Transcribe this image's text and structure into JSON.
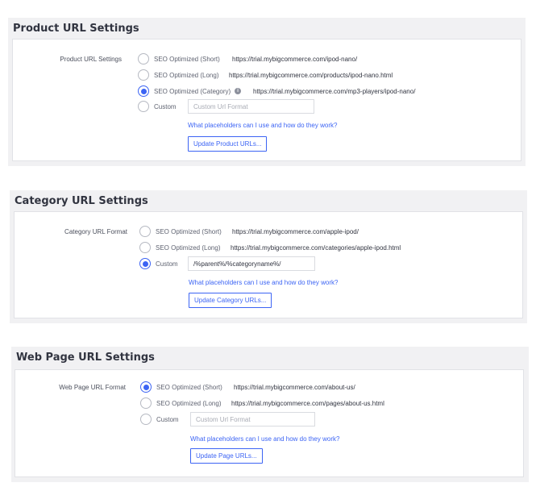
{
  "product": {
    "title": "Product URL Settings",
    "row_label": "Product URL Settings",
    "options": [
      {
        "label": "SEO Optimized (Short)",
        "url": "https://trial.mybigcommerce.com/ipod-nano/",
        "checked": false
      },
      {
        "label": "SEO Optimized (Long)",
        "url": "https://trial.mybigcommerce.com/products/ipod-nano.html",
        "checked": false
      },
      {
        "label": "SEO Optimized (Category)",
        "url": "https://trial.mybigcommerce.com/mp3-players/ipod-nano/",
        "checked": true
      },
      {
        "label": "Custom",
        "url": "",
        "checked": false
      }
    ],
    "custom_placeholder": "Custom Url Format",
    "custom_value": "",
    "help_link": "What placeholders can I use and how do they work?",
    "button": "Update Product URLs..."
  },
  "category": {
    "title": "Category URL Settings",
    "row_label": "Category URL Format",
    "options": [
      {
        "label": "SEO Optimized (Short)",
        "url": "https://trial.mybigcommerce.com/apple-ipod/",
        "checked": false
      },
      {
        "label": "SEO Optimized (Long)",
        "url": "https://trial.mybigcommerce.com/categories/apple-ipod.html",
        "checked": false
      },
      {
        "label": "Custom",
        "url": "",
        "checked": true
      }
    ],
    "custom_placeholder": "",
    "custom_value": "/%parent%/%categoryname%/",
    "help_link": "What placeholders can I use and how do they work?",
    "button": "Update Category URLs..."
  },
  "webpage": {
    "title": "Web Page URL Settings",
    "row_label": "Web Page URL Format",
    "options": [
      {
        "label": "SEO Optimized (Short)",
        "url": "https://trial.mybigcommerce.com/about-us/",
        "checked": true
      },
      {
        "label": "SEO Optimized (Long)",
        "url": "https://trial.mybigcommerce.com/pages/about-us.html",
        "checked": false
      },
      {
        "label": "Custom",
        "url": "",
        "checked": false
      }
    ],
    "custom_placeholder": "Custom Url Format",
    "custom_value": "",
    "help_link": "What placeholders can I use and how do they work?",
    "button": "Update Page URLs..."
  },
  "colors": {
    "accent": "#3c64f4",
    "panel_bg": "#f1f1f3",
    "text": "#313440"
  },
  "icons": {
    "info": "info-circle-icon"
  }
}
